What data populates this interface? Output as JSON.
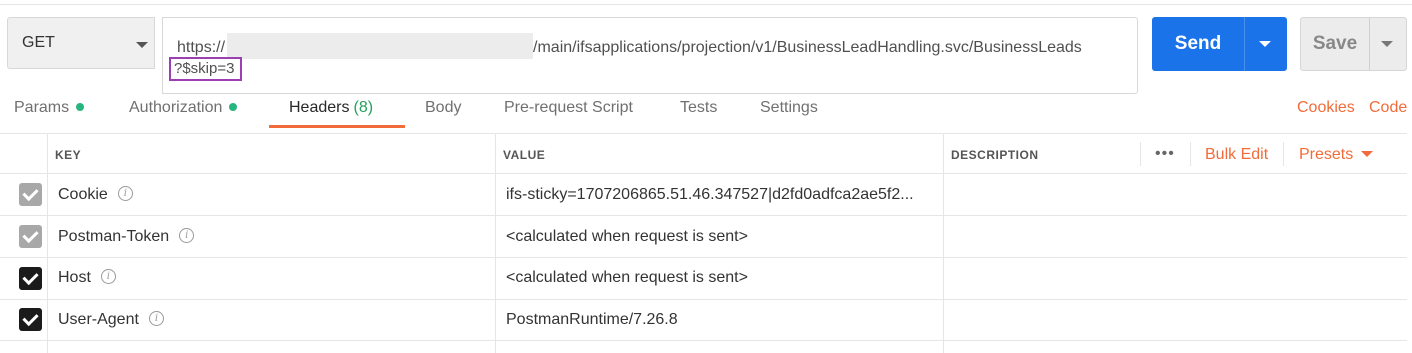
{
  "request": {
    "method": "GET",
    "url_prefix": "https://",
    "url_suffix": "/main/ifsapplications/projection/v1/BusinessLeadHandling.svc/BusinessLeads",
    "url_query": "?$skip=3",
    "send_label": "Send",
    "save_label": "Save"
  },
  "tabs": [
    {
      "label": "Params",
      "has_dot": true
    },
    {
      "label": "Authorization",
      "has_dot": true
    },
    {
      "label": "Headers",
      "count": "(8)",
      "active": true
    },
    {
      "label": "Body"
    },
    {
      "label": "Pre-request Script"
    },
    {
      "label": "Tests"
    },
    {
      "label": "Settings"
    }
  ],
  "right_links": {
    "cookies": "Cookies",
    "code": "Code"
  },
  "table": {
    "columns": {
      "key": "KEY",
      "value": "VALUE",
      "description": "DESCRIPTION"
    },
    "more_icon": "more-horizontal-icon",
    "bulk_edit": "Bulk Edit",
    "presets": "Presets",
    "rows": [
      {
        "key": "Cookie",
        "value": "ifs-sticky=1707206865.51.46.347527|d2fd0adfca2ae5f2...",
        "checked": true,
        "disabled": true
      },
      {
        "key": "Postman-Token",
        "value": "<calculated when request is sent>",
        "checked": true,
        "disabled": true
      },
      {
        "key": "Host",
        "value": "<calculated when request is sent>",
        "checked": true,
        "disabled": false
      },
      {
        "key": "User-Agent",
        "value": "PostmanRuntime/7.26.8",
        "checked": true,
        "disabled": false
      }
    ]
  },
  "colors": {
    "accent": "#f26b3a",
    "send": "#1a73e8",
    "highlight_box": "#9b3fb3",
    "dot": "#26b47f"
  }
}
